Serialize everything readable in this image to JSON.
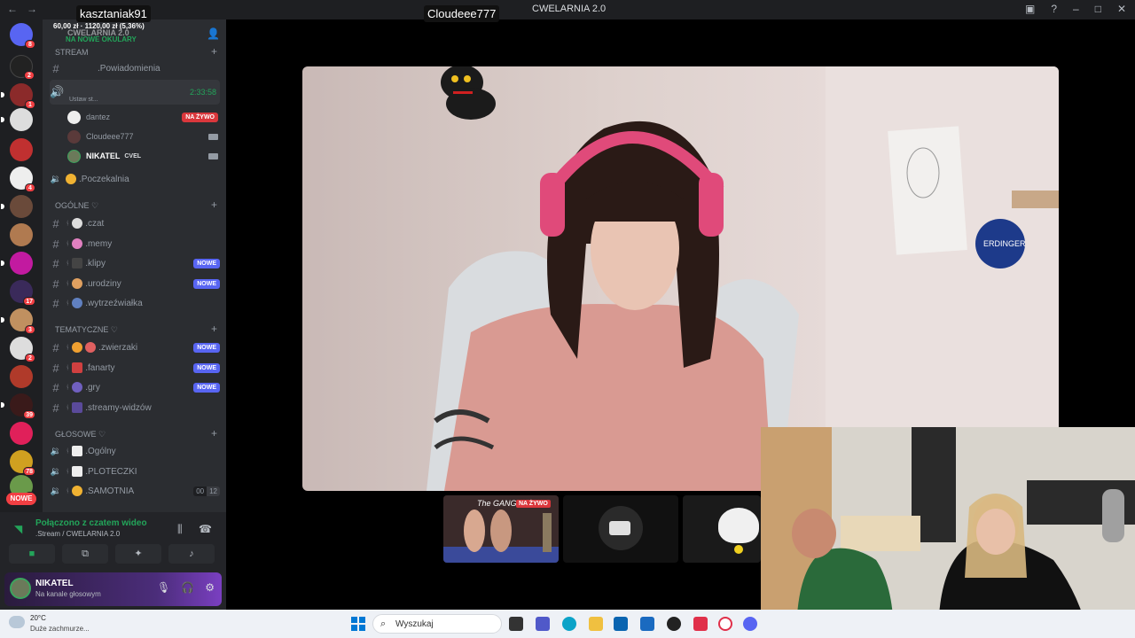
{
  "window": {
    "title": "CWELARNIA 2.0",
    "back": "←",
    "forward": "→"
  },
  "server": {
    "name": "CWELARNIA 2.0",
    "overlay_top": "60,00 zł · 1120,00 zł (5,36%)",
    "overlay_tag": "NA NOWE OKULARY"
  },
  "guilds": {
    "badges": [
      "8",
      "2",
      "1",
      "",
      "",
      "4",
      "",
      "",
      "",
      "",
      "17",
      "3",
      "2",
      "",
      "39",
      "",
      "78",
      "2"
    ],
    "new_label": "NOWE"
  },
  "categories": {
    "stream": "STREAM",
    "ogolne": "OGÓLNE ♡",
    "tematyczne": "TEMATYCZNE ♡",
    "glosowe": "GŁOSOWE ♡"
  },
  "stream_section": {
    "row1": ".Powiadomienia",
    "row2_timer": "2:33:58",
    "row2_sub": "Ustaw st...",
    "users": [
      {
        "name": "dantez",
        "live": "NA ŻYWO"
      },
      {
        "name": "Cloudeee777"
      },
      {
        "name": "NIKATEL",
        "tag": "CVEL"
      }
    ],
    "waiting": ".Poczekalnia"
  },
  "ogolne_channels": [
    {
      "name": ".czat"
    },
    {
      "name": ".memy"
    },
    {
      "name": ".klipy",
      "badge": "NOWE"
    },
    {
      "name": ".urodziny",
      "badge": "NOWE"
    },
    {
      "name": ".wytrzeźwiałka"
    }
  ],
  "tematyczne_channels": [
    {
      "name": ".zwierzaki",
      "badge": "NOWE"
    },
    {
      "name": ".fanarty",
      "badge": "NOWE"
    },
    {
      "name": ".gry",
      "badge": "NOWE"
    },
    {
      "name": ".streamy-widzów"
    }
  ],
  "glosowe_channels": [
    {
      "name": ".Ogólny"
    },
    {
      "name": ".PLOTECZKI"
    },
    {
      "name": ".SAMOTNIA",
      "count_a": "00",
      "count_b": "12"
    }
  ],
  "connection": {
    "title": "Połączono z czatem wideo",
    "subtitle": ".Stream / CWELARNIA 2.0"
  },
  "user_panel": {
    "name": "NIKATEL",
    "status": "Na kanale głosowym"
  },
  "stage": {
    "tag_left": "kasztaniak91",
    "tag_center": "Cloudeee777",
    "main_poster_text": "ERDINGER",
    "thumb_live": "NA ŻYWO",
    "thumb_title": "The GANG"
  },
  "taskbar": {
    "weather_temp": "20°C",
    "weather_desc": "Duże zachmurze...",
    "search_placeholder": "Wyszukaj"
  }
}
